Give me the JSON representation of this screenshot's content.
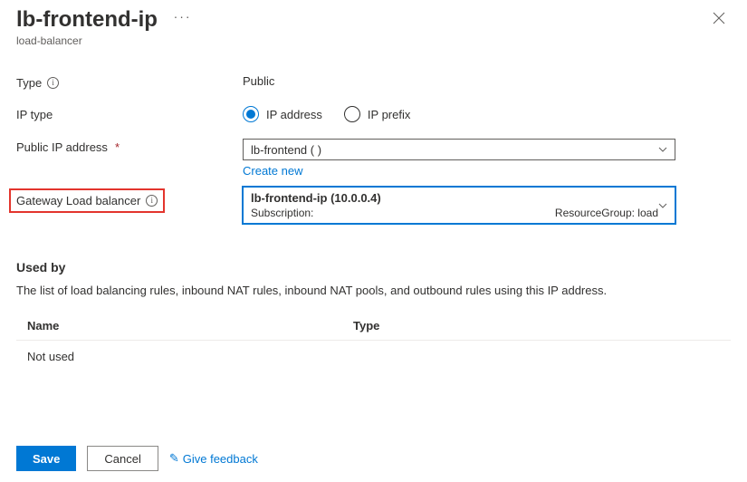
{
  "header": {
    "title": "lb-frontend-ip",
    "subtitle": "load-balancer"
  },
  "form": {
    "type_label": "Type",
    "type_value": "Public",
    "ip_type_label": "IP type",
    "ip_type_options": {
      "address": "IP address",
      "prefix": "IP prefix"
    },
    "public_ip_label": "Public IP address",
    "public_ip_value": "lb-frontend (                           )",
    "create_new": "Create new",
    "gateway_label": "Gateway Load balancer",
    "gateway_selected_title": "lb-frontend-ip (10.0.0.4)",
    "gateway_selected_sub_left": "Subscription:",
    "gateway_selected_sub_right": "ResourceGroup: load"
  },
  "used_by": {
    "heading": "Used by",
    "description": "The list of load balancing rules, inbound NAT rules, inbound NAT pools, and outbound rules using this IP address.",
    "col_name": "Name",
    "col_type": "Type",
    "empty": "Not used"
  },
  "footer": {
    "save": "Save",
    "cancel": "Cancel",
    "feedback": "Give feedback"
  }
}
